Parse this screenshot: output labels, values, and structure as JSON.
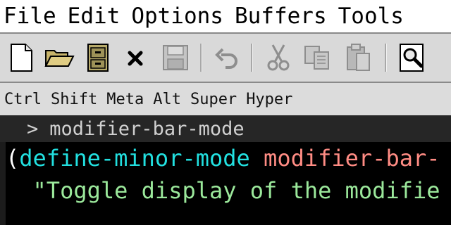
{
  "menubar": {
    "items": [
      "File",
      "Edit",
      "Options",
      "Buffers",
      "Tools"
    ]
  },
  "toolbar": {
    "buttons": [
      {
        "icon": "new-file-icon",
        "enabled": true
      },
      {
        "icon": "open-folder-icon",
        "enabled": true
      },
      {
        "icon": "dired-cabinet-icon",
        "enabled": true
      },
      {
        "icon": "close-buffer-icon",
        "enabled": true
      },
      {
        "icon": "save-icon",
        "enabled": false
      },
      {
        "icon": "undo-icon",
        "enabled": false
      },
      {
        "icon": "cut-icon",
        "enabled": false
      },
      {
        "icon": "copy-icon",
        "enabled": false
      },
      {
        "icon": "paste-icon",
        "enabled": false
      },
      {
        "icon": "search-icon",
        "enabled": true
      }
    ]
  },
  "modifier_bar": {
    "keys": [
      "Ctrl",
      "Shift",
      "Meta",
      "Alt",
      "Super",
      "Hyper"
    ]
  },
  "header_line": {
    "prompt": ">",
    "name": "modifier-bar-mode"
  },
  "buffer": {
    "line1": {
      "open_paren": "(",
      "keyword": "define-minor-mode",
      "function_name": "modifier-bar-"
    },
    "line2": {
      "indent": "  ",
      "docstring": "\"Toggle display of the modifie"
    }
  },
  "colors": {
    "keyword": "#22e0e0",
    "function_name": "#ff8c84",
    "string": "#9be89b",
    "background": "#000000",
    "toolbar_bg": "#d9d9d9"
  }
}
